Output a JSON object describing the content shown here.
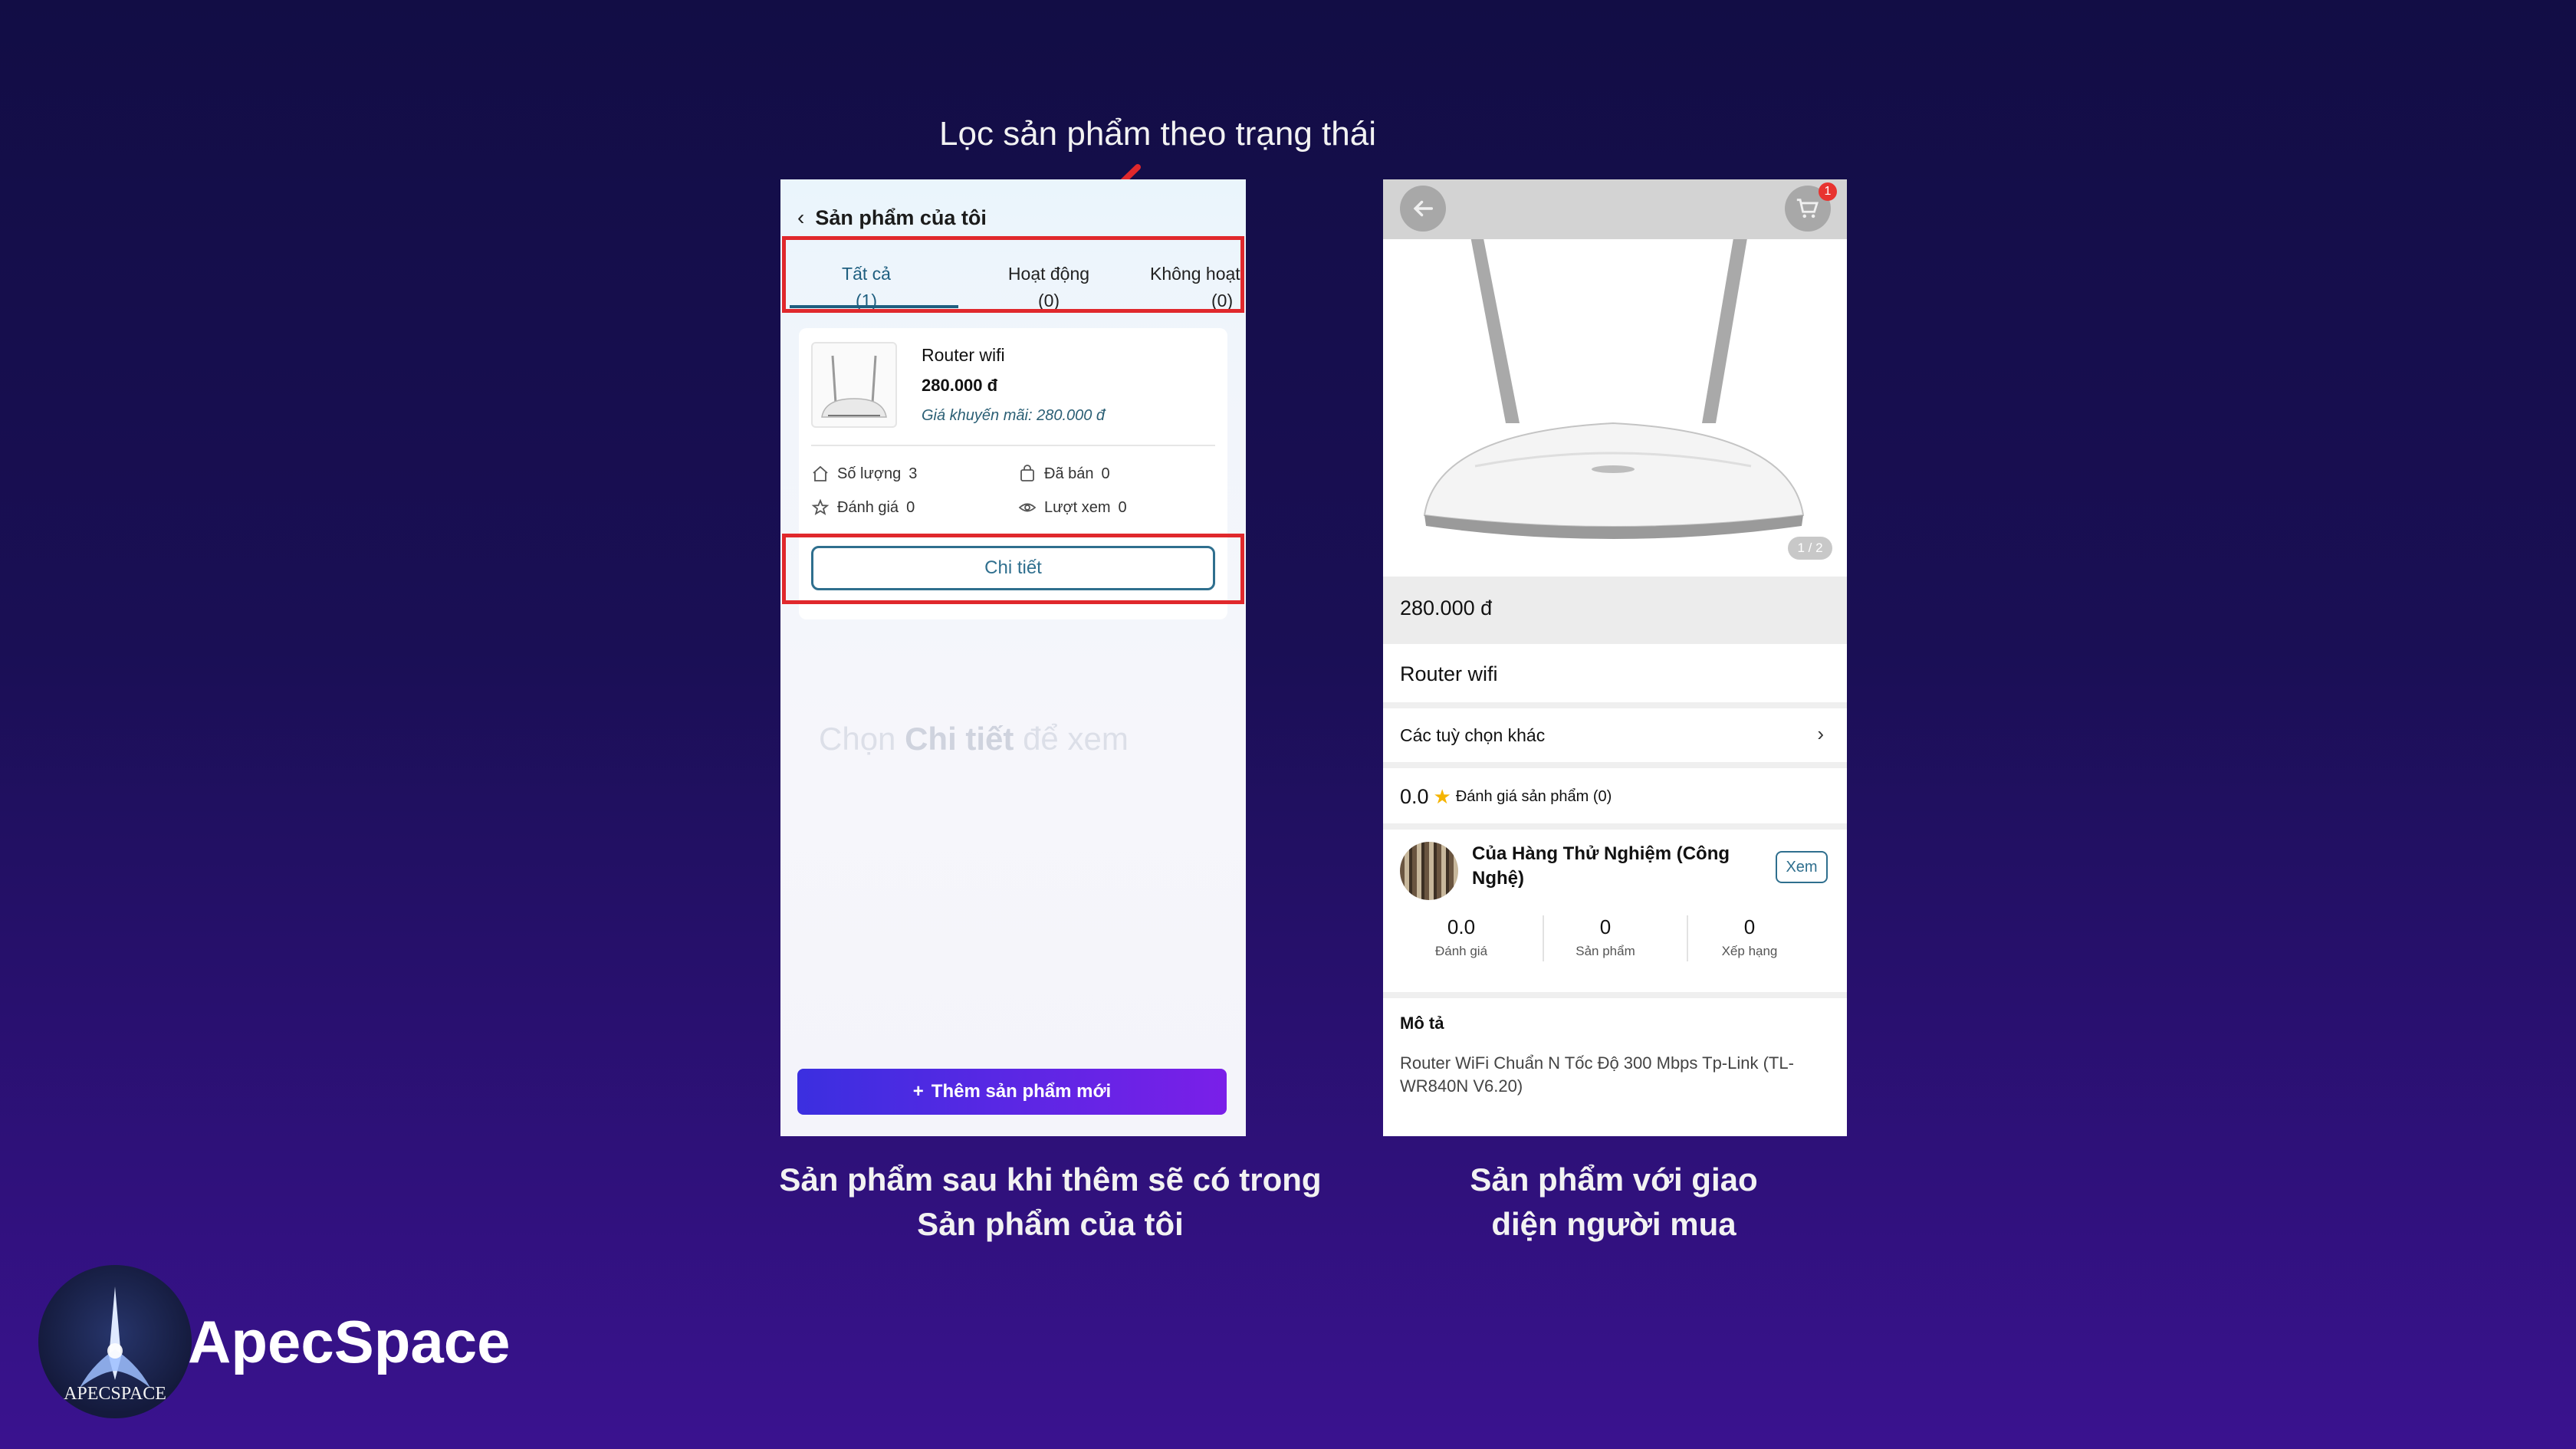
{
  "annotations": {
    "top_note": "Lọc sản phẩm theo trạng thái",
    "caption_left_line1": "Sản phẩm sau khi thêm sẽ có trong",
    "caption_left_line2": "Sản phẩm của tôi",
    "caption_right_line1": "Sản phẩm với giao",
    "caption_right_line2": "diện người mua",
    "arrow_color": "#e0282c"
  },
  "seller_screen": {
    "title": "Sản phẩm của tôi",
    "tabs": [
      {
        "label": "Tất cả",
        "count": "(1)"
      },
      {
        "label": "Hoạt động",
        "count": "(0)"
      },
      {
        "label": "Không hoạt",
        "count": "(0)"
      }
    ],
    "product": {
      "name": "Router wifi",
      "price": "280.000 đ",
      "promo": "Giá khuyến mãi: 280.000 đ",
      "stats": [
        {
          "icon": "home-icon",
          "label": "Số lượng",
          "value": "3"
        },
        {
          "icon": "bag-icon",
          "label": "Đã bán",
          "value": "0"
        },
        {
          "icon": "star-icon",
          "label": "Đánh giá",
          "value": "0"
        },
        {
          "icon": "eye-icon",
          "label": "Lượt xem",
          "value": "0"
        }
      ],
      "detail_button": "Chi tiết"
    },
    "hint_prefix": "Chọn",
    "hint_bold": "Chi tiết",
    "hint_suffix": "để xem",
    "add_button": "Thêm sản phẩm mới"
  },
  "buyer_screen": {
    "cart_badge": "1",
    "image_counter": "1 / 2",
    "price": "280.000 đ",
    "name": "Router wifi",
    "options_label": "Các tuỳ chọn khác",
    "rating_value": "0.0",
    "rating_label": "Đánh giá sản phẩm (0)",
    "shop": {
      "name": "Của Hàng Thử Nghiệm (Công Nghệ)",
      "view_button": "Xem",
      "stats": [
        {
          "value": "0.0",
          "label": "Đánh giá"
        },
        {
          "value": "0",
          "label": "Sản phẩm"
        },
        {
          "value": "0",
          "label": "Xếp hạng"
        }
      ]
    },
    "description_title": "Mô tả",
    "description": "Router WiFi Chuẩn N Tốc Độ 300 Mbps Tp-Link (TL-WR840N V6.20)"
  },
  "brand": {
    "name": "ApecSpace",
    "logo_text": "APECSPACE"
  }
}
